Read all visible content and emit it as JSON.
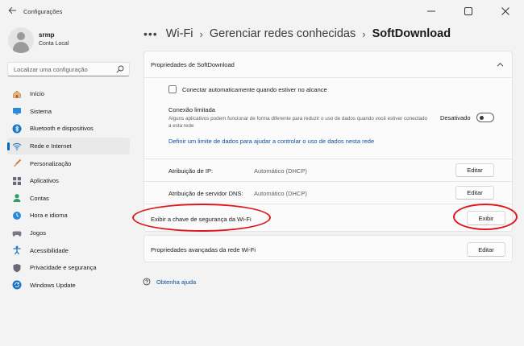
{
  "window": {
    "title": "Configurações"
  },
  "profile": {
    "name": "srmp",
    "account_type": "Conta Local"
  },
  "search": {
    "placeholder": "Localizar uma configuração"
  },
  "sidebar": {
    "items": [
      {
        "label": "Início",
        "icon": "home-icon"
      },
      {
        "label": "Sistema",
        "icon": "system-icon"
      },
      {
        "label": "Bluetooth e dispositivos",
        "icon": "bluetooth-icon"
      },
      {
        "label": "Rede e Internet",
        "icon": "wifi-icon",
        "selected": true
      },
      {
        "label": "Personalização",
        "icon": "brush-icon"
      },
      {
        "label": "Aplicativos",
        "icon": "apps-icon"
      },
      {
        "label": "Contas",
        "icon": "person-icon"
      },
      {
        "label": "Hora e idioma",
        "icon": "globe-clock-icon"
      },
      {
        "label": "Jogos",
        "icon": "gamepad-icon"
      },
      {
        "label": "Acessibilidade",
        "icon": "accessibility-icon"
      },
      {
        "label": "Privacidade e segurança",
        "icon": "shield-icon"
      },
      {
        "label": "Windows Update",
        "icon": "update-icon"
      }
    ]
  },
  "breadcrumb": {
    "more": "•••",
    "items": [
      "Wi-Fi",
      "Gerenciar redes conhecidas"
    ],
    "current": "SoftDownload"
  },
  "properties": {
    "title": "Propriedades de SoftDownload",
    "auto_connect_label": "Conectar automaticamente quando estiver no alcance",
    "auto_connect_checked": false,
    "metered": {
      "title": "Conexão limitada",
      "description": "Alguns aplicativos podem funcionar de forma diferente para reduzir o uso de dados quando você estiver conectado a esta rede",
      "state_label": "Desativado",
      "enabled": false
    },
    "data_limit_link": "Definir um limite de dados para ajudar a controlar o uso de dados nesta rede",
    "ip_assignment": {
      "label": "Atribuição de IP:",
      "value": "Automático (DHCP)",
      "button": "Editar"
    },
    "dns_assignment": {
      "label": "Atribuição de servidor DNS:",
      "value": "Automático (DHCP)",
      "button": "Editar"
    },
    "security_key": {
      "label": "Exibir a chave de segurança da Wi-Fi",
      "button": "Exibir"
    }
  },
  "advanced": {
    "label": "Propriedades avançadas da rede Wi-Fi",
    "button": "Editar"
  },
  "help": {
    "label": "Obtenha ajuda"
  },
  "colors": {
    "accent": "#0067c0",
    "link": "#0b4f9c",
    "annotation": "#e0161b"
  }
}
